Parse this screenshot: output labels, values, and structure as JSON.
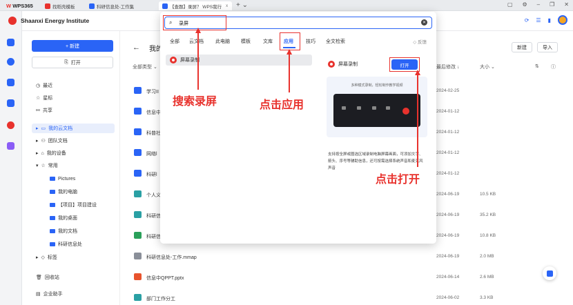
{
  "tabs": [
    {
      "label": "WPS365",
      "color": "#e8322d"
    },
    {
      "label": "找稻壳模板",
      "color": "#e8322d"
    },
    {
      "label": "科研信息处-工作集",
      "color": "#2a64f6"
    },
    {
      "label": "【查题】录屏？ WPS我行",
      "color": "#2a64f6",
      "extra": "x"
    }
  ],
  "org_name": "Shaanxi Energy Institute",
  "sidebar": {
    "new_label": "+ 新建",
    "open_label": "打开",
    "nav": [
      "最近",
      "星标",
      "共享",
      "我的云文档",
      "团队文档",
      "我的设备",
      "常用"
    ],
    "sub": [
      "Pictures",
      "我的电脑",
      "【项目】项目建设",
      "我的桌面",
      "我的文档",
      "科研信息处"
    ],
    "bottom": [
      "标签",
      "回收站",
      "企业助手"
    ]
  },
  "main": {
    "back": "←",
    "crumb": "我的",
    "new_btn": "新建",
    "import_btn": "导入",
    "col_type": "全部类型 ⌄",
    "col_modified": "最后修改 ↓",
    "col_size": "大小 ⌄",
    "rows": [
      {
        "name": "学习II",
        "date": "2024-02-25",
        "size": "",
        "color": "#2a64f6"
      },
      {
        "name": "信息中",
        "date": "2024-01-12",
        "size": "",
        "color": "#2a64f6"
      },
      {
        "name": "科普社",
        "date": "2024-01-12",
        "size": "",
        "color": "#2a64f6"
      },
      {
        "name": "网络l",
        "date": "2024-01-12",
        "size": "",
        "color": "#2a64f6"
      },
      {
        "name": "科研l",
        "date": "2024-01-12",
        "size": "",
        "color": "#2a64f6"
      },
      {
        "name": "个人义",
        "date": "2024-06-19",
        "size": "10.5 KB",
        "color": "#2aa0a4"
      },
      {
        "name": "科研信",
        "date": "2024-06-19",
        "size": "35.2 KB",
        "color": "#2aa0a4"
      },
      {
        "name": "科研信",
        "date": "2024-06-19",
        "size": "10.8 KB",
        "color": "#2aa05a"
      },
      {
        "name": "科研信息处-工作.mmap",
        "date": "2024-06-19",
        "size": "2.0 MB",
        "color": "#8a8f99"
      },
      {
        "name": "信息中QPPT.pptx",
        "date": "2024-06-14",
        "size": "2.6 MB",
        "color": "#e8532d"
      },
      {
        "name": "部门工作分工",
        "date": "2024-06-02",
        "size": "3.3 KB",
        "color": "#2aa0a4"
      }
    ]
  },
  "popup": {
    "search_value": "录屏",
    "tabs": [
      "全部",
      "云文档",
      "此电脑",
      "模板",
      "文库",
      "应用",
      "技巧",
      "全文检索"
    ],
    "selected_tab": "应用",
    "feedback": "◇ 反馈",
    "result": "屏幕录制",
    "detail_title": "屏幕录制",
    "detail_open": "打开",
    "preview_caption": "多种模式录制，轻松制作教学视频",
    "description": "支持按全屏或圈选区域录制电脑屏幕画面，可添加文字、箭头、序号等辅助信息，还可按需选择系统声音和麦克风声音"
  },
  "annotations": {
    "search": "搜索录屏",
    "click_app": "点击应用",
    "click_open": "点击打开"
  },
  "colors": {
    "accent": "#2a64f6",
    "annotation": "#e8322d"
  }
}
